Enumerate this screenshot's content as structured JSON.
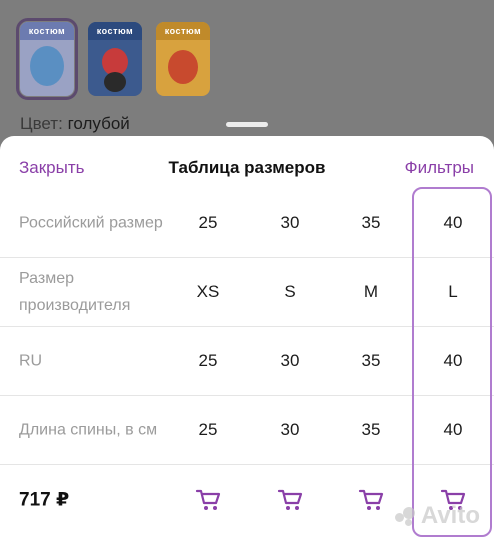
{
  "background": {
    "color_label": "Цвет:",
    "color_value": "голубой",
    "thumbnails": [
      {
        "caption": "костюм",
        "bg": "#9aa2c4",
        "accent": "#5a8fc2",
        "selected": true
      },
      {
        "caption": "костюм",
        "bg": "#3c5a8e",
        "accent": "#c73b3b",
        "selected": false
      },
      {
        "caption": "костюм",
        "bg": "#d8a23e",
        "accent": "#c84a2e",
        "selected": false
      }
    ]
  },
  "sheet": {
    "close_label": "Закрыть",
    "title": "Таблица размеров",
    "filters_label": "Фильтры"
  },
  "table": {
    "rows": [
      {
        "label": "Российский размер",
        "values": [
          "25",
          "30",
          "35",
          "40"
        ]
      },
      {
        "label": "Размер производителя",
        "values": [
          "XS",
          "S",
          "M",
          "L"
        ]
      },
      {
        "label": "RU",
        "values": [
          "25",
          "30",
          "35",
          "40"
        ]
      },
      {
        "label": "Длина спины, в см",
        "values": [
          "25",
          "30",
          "35",
          "40"
        ]
      }
    ],
    "price": "717 ₽",
    "cart_icon": "cart-icon",
    "highlighted_column_index": 3
  },
  "colors": {
    "accent": "#8a3fa8",
    "highlight_border": "#b07ccf",
    "label_gray": "#9b9b9b"
  },
  "watermark": "Avito"
}
